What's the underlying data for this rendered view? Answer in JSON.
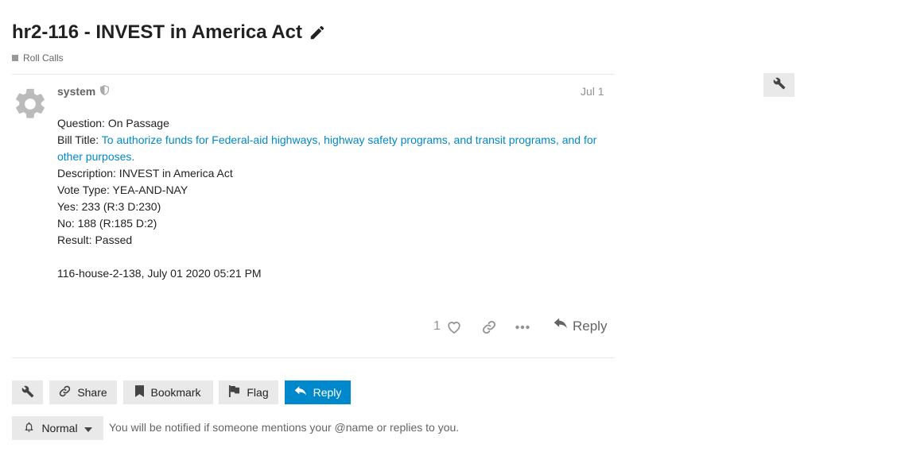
{
  "topic": {
    "title": "hr2-116 - INVEST in America Act",
    "category": "Roll Calls"
  },
  "post": {
    "username": "system",
    "date": "Jul 1",
    "question": "Question: On Passage",
    "bill_title_label": "Bill Title: ",
    "bill_title_link": "To authorize funds for Federal-aid highways, highway safety programs, and transit programs, and for other purposes.",
    "description": "Description: INVEST in America Act",
    "vote_type": "Vote Type: YEA-AND-NAY",
    "yes": "Yes: 233 (R:3 D:230)",
    "no": "No: 188 (R:185 D:2)",
    "result": "Result: Passed",
    "footer_line": "116-house-2-138, July 01 2020 05:21 PM",
    "like_count": "1",
    "reply_label": "Reply"
  },
  "footer_buttons": {
    "share": "Share",
    "bookmark": "Bookmark",
    "flag": "Flag",
    "reply": "Reply"
  },
  "notifications": {
    "level": "Normal",
    "description": "You will be notified if someone mentions your @name or replies to you."
  },
  "colors": {
    "link": "#0088cc",
    "primary_button": "#0088cc",
    "muted": "#919191"
  }
}
